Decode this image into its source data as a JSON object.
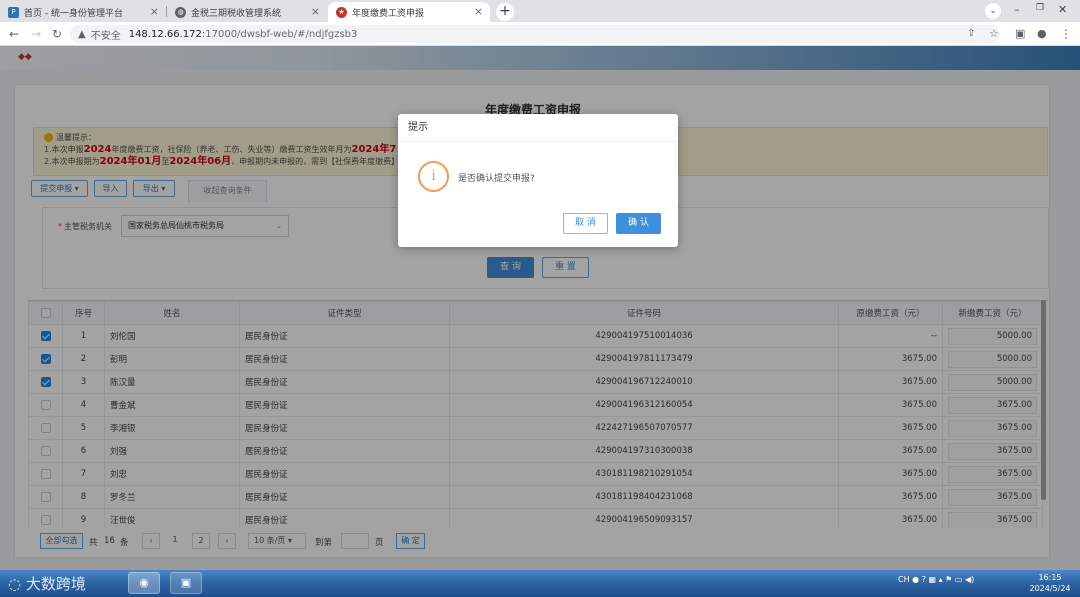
{
  "browser": {
    "tabs": [
      {
        "label": "首页 - 统一身份管理平台",
        "icon": "portal-icon"
      },
      {
        "label": "金税三期税收管理系统",
        "icon": "globe-icon"
      },
      {
        "label": "年度缴费工资申报",
        "icon": "tax-emblem-icon"
      }
    ],
    "new_tab": "+",
    "security_label": "不安全",
    "url_host": "148.12.66.172",
    "url_path": ":17000/dwsbf-web/#/ndjfgzsb3"
  },
  "page": {
    "title": "年度缴费工资申报",
    "notice": {
      "heading": "温馨提示：",
      "line1_prefix": "1.本次申报",
      "line1_year": "2024",
      "line1_mid": "年度缴费工资，社保险（养老、工伤、失业等）缴费工资生效年月为",
      "line1_year2": "2024年7",
      "line2_prefix": "2.本次申报期为",
      "line2_from": "2024年01月",
      "line2_mid": "至",
      "line2_to": "2024年06月",
      "line2_suffix": "，申报期内未申报的，需到【社保费年度缴费】"
    },
    "action_buttons": {
      "submit": "提交申报",
      "import": "导入",
      "export": "导出"
    },
    "query_tab": "收起查询条件",
    "query": {
      "field_label": "主管税务机关",
      "required_mark": "*",
      "field_value": "国家税务总局仙桃市税务局",
      "search": "查 询",
      "reset": "重 置"
    },
    "table": {
      "headers": [
        "",
        "序号",
        "姓名",
        "证件类型",
        "证件号码",
        "原缴费工资（元）",
        "新缴费工资（元）"
      ],
      "rows": [
        {
          "checked": true,
          "no": "1",
          "name": "刘伦国",
          "id_type": "居民身份证",
          "id_no": "429004197510014036",
          "old_wage": "--",
          "new_wage": "5000.00"
        },
        {
          "checked": true,
          "no": "2",
          "name": "彭明",
          "id_type": "居民身份证",
          "id_no": "429004197811173479",
          "old_wage": "3675.00",
          "new_wage": "5000.00"
        },
        {
          "checked": true,
          "no": "3",
          "name": "陈汉量",
          "id_type": "居民身份证",
          "id_no": "429004196712240010",
          "old_wage": "3675.00",
          "new_wage": "5000.00"
        },
        {
          "checked": false,
          "no": "4",
          "name": "曹金斌",
          "id_type": "居民身份证",
          "id_no": "429004196312160054",
          "old_wage": "3675.00",
          "new_wage": "3675.00"
        },
        {
          "checked": false,
          "no": "5",
          "name": "李湘银",
          "id_type": "居民身份证",
          "id_no": "422427196507070577",
          "old_wage": "3675.00",
          "new_wage": "3675.00"
        },
        {
          "checked": false,
          "no": "6",
          "name": "刘强",
          "id_type": "居民身份证",
          "id_no": "429004197310300038",
          "old_wage": "3675.00",
          "new_wage": "3675.00"
        },
        {
          "checked": false,
          "no": "7",
          "name": "刘忠",
          "id_type": "居民身份证",
          "id_no": "430181198210291054",
          "old_wage": "3675.00",
          "new_wage": "3675.00"
        },
        {
          "checked": false,
          "no": "8",
          "name": "罗冬兰",
          "id_type": "居民身份证",
          "id_no": "430181198404231068",
          "old_wage": "3675.00",
          "new_wage": "3675.00"
        },
        {
          "checked": false,
          "no": "9",
          "name": "汪世俊",
          "id_type": "居民身份证",
          "id_no": "429004196509093157",
          "old_wage": "3675.00",
          "new_wage": "3675.00"
        }
      ]
    },
    "pager": {
      "select_all": "全部勾选",
      "total_prefix": "共",
      "total": "16",
      "total_suffix": "条",
      "prev": "‹",
      "page1": "1",
      "page2": "2",
      "next": "›",
      "page_size": "10 条/页",
      "goto_prefix": "到第",
      "goto_suffix": "页",
      "confirm": "确 定"
    }
  },
  "dialog": {
    "title": "提示",
    "icon": "info-icon",
    "message": "是否确认提交申报?",
    "cancel": "取 消",
    "confirm": "确 认"
  },
  "taskbar": {
    "watermark": "大数跨境",
    "time": "16:15",
    "date": "2024/5/24",
    "tray_text": "CH"
  },
  "colors": {
    "accent": "#2e75b6",
    "primary_button": "#3f8fdc",
    "warning": "#f39c53",
    "notice_red": "#d0021b",
    "checkbox_on": "#1e88e5"
  }
}
